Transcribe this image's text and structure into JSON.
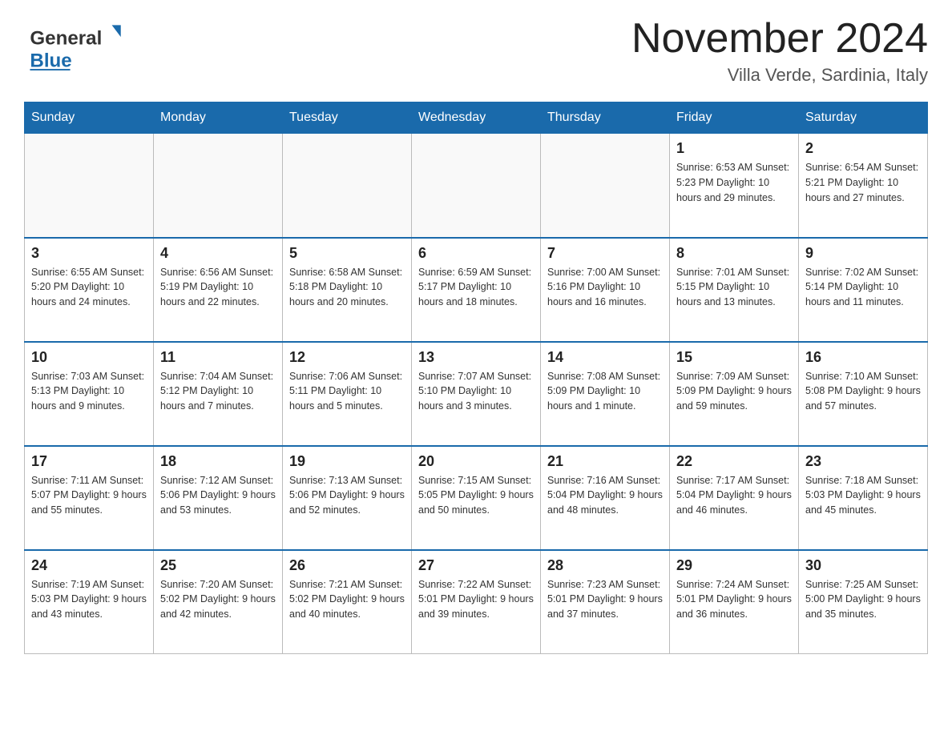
{
  "header": {
    "logo": {
      "general_text": "General",
      "blue_text": "Blue"
    },
    "title": "November 2024",
    "location": "Villa Verde, Sardinia, Italy"
  },
  "days_of_week": [
    "Sunday",
    "Monday",
    "Tuesday",
    "Wednesday",
    "Thursday",
    "Friday",
    "Saturday"
  ],
  "weeks": [
    {
      "days": [
        {
          "num": "",
          "info": ""
        },
        {
          "num": "",
          "info": ""
        },
        {
          "num": "",
          "info": ""
        },
        {
          "num": "",
          "info": ""
        },
        {
          "num": "",
          "info": ""
        },
        {
          "num": "1",
          "info": "Sunrise: 6:53 AM\nSunset: 5:23 PM\nDaylight: 10 hours\nand 29 minutes."
        },
        {
          "num": "2",
          "info": "Sunrise: 6:54 AM\nSunset: 5:21 PM\nDaylight: 10 hours\nand 27 minutes."
        }
      ]
    },
    {
      "days": [
        {
          "num": "3",
          "info": "Sunrise: 6:55 AM\nSunset: 5:20 PM\nDaylight: 10 hours\nand 24 minutes."
        },
        {
          "num": "4",
          "info": "Sunrise: 6:56 AM\nSunset: 5:19 PM\nDaylight: 10 hours\nand 22 minutes."
        },
        {
          "num": "5",
          "info": "Sunrise: 6:58 AM\nSunset: 5:18 PM\nDaylight: 10 hours\nand 20 minutes."
        },
        {
          "num": "6",
          "info": "Sunrise: 6:59 AM\nSunset: 5:17 PM\nDaylight: 10 hours\nand 18 minutes."
        },
        {
          "num": "7",
          "info": "Sunrise: 7:00 AM\nSunset: 5:16 PM\nDaylight: 10 hours\nand 16 minutes."
        },
        {
          "num": "8",
          "info": "Sunrise: 7:01 AM\nSunset: 5:15 PM\nDaylight: 10 hours\nand 13 minutes."
        },
        {
          "num": "9",
          "info": "Sunrise: 7:02 AM\nSunset: 5:14 PM\nDaylight: 10 hours\nand 11 minutes."
        }
      ]
    },
    {
      "days": [
        {
          "num": "10",
          "info": "Sunrise: 7:03 AM\nSunset: 5:13 PM\nDaylight: 10 hours\nand 9 minutes."
        },
        {
          "num": "11",
          "info": "Sunrise: 7:04 AM\nSunset: 5:12 PM\nDaylight: 10 hours\nand 7 minutes."
        },
        {
          "num": "12",
          "info": "Sunrise: 7:06 AM\nSunset: 5:11 PM\nDaylight: 10 hours\nand 5 minutes."
        },
        {
          "num": "13",
          "info": "Sunrise: 7:07 AM\nSunset: 5:10 PM\nDaylight: 10 hours\nand 3 minutes."
        },
        {
          "num": "14",
          "info": "Sunrise: 7:08 AM\nSunset: 5:09 PM\nDaylight: 10 hours\nand 1 minute."
        },
        {
          "num": "15",
          "info": "Sunrise: 7:09 AM\nSunset: 5:09 PM\nDaylight: 9 hours\nand 59 minutes."
        },
        {
          "num": "16",
          "info": "Sunrise: 7:10 AM\nSunset: 5:08 PM\nDaylight: 9 hours\nand 57 minutes."
        }
      ]
    },
    {
      "days": [
        {
          "num": "17",
          "info": "Sunrise: 7:11 AM\nSunset: 5:07 PM\nDaylight: 9 hours\nand 55 minutes."
        },
        {
          "num": "18",
          "info": "Sunrise: 7:12 AM\nSunset: 5:06 PM\nDaylight: 9 hours\nand 53 minutes."
        },
        {
          "num": "19",
          "info": "Sunrise: 7:13 AM\nSunset: 5:06 PM\nDaylight: 9 hours\nand 52 minutes."
        },
        {
          "num": "20",
          "info": "Sunrise: 7:15 AM\nSunset: 5:05 PM\nDaylight: 9 hours\nand 50 minutes."
        },
        {
          "num": "21",
          "info": "Sunrise: 7:16 AM\nSunset: 5:04 PM\nDaylight: 9 hours\nand 48 minutes."
        },
        {
          "num": "22",
          "info": "Sunrise: 7:17 AM\nSunset: 5:04 PM\nDaylight: 9 hours\nand 46 minutes."
        },
        {
          "num": "23",
          "info": "Sunrise: 7:18 AM\nSunset: 5:03 PM\nDaylight: 9 hours\nand 45 minutes."
        }
      ]
    },
    {
      "days": [
        {
          "num": "24",
          "info": "Sunrise: 7:19 AM\nSunset: 5:03 PM\nDaylight: 9 hours\nand 43 minutes."
        },
        {
          "num": "25",
          "info": "Sunrise: 7:20 AM\nSunset: 5:02 PM\nDaylight: 9 hours\nand 42 minutes."
        },
        {
          "num": "26",
          "info": "Sunrise: 7:21 AM\nSunset: 5:02 PM\nDaylight: 9 hours\nand 40 minutes."
        },
        {
          "num": "27",
          "info": "Sunrise: 7:22 AM\nSunset: 5:01 PM\nDaylight: 9 hours\nand 39 minutes."
        },
        {
          "num": "28",
          "info": "Sunrise: 7:23 AM\nSunset: 5:01 PM\nDaylight: 9 hours\nand 37 minutes."
        },
        {
          "num": "29",
          "info": "Sunrise: 7:24 AM\nSunset: 5:01 PM\nDaylight: 9 hours\nand 36 minutes."
        },
        {
          "num": "30",
          "info": "Sunrise: 7:25 AM\nSunset: 5:00 PM\nDaylight: 9 hours\nand 35 minutes."
        }
      ]
    }
  ],
  "colors": {
    "header_bg": "#1a6aab",
    "header_text": "#ffffff",
    "border": "#999999",
    "row_divider": "#1a6aab"
  }
}
